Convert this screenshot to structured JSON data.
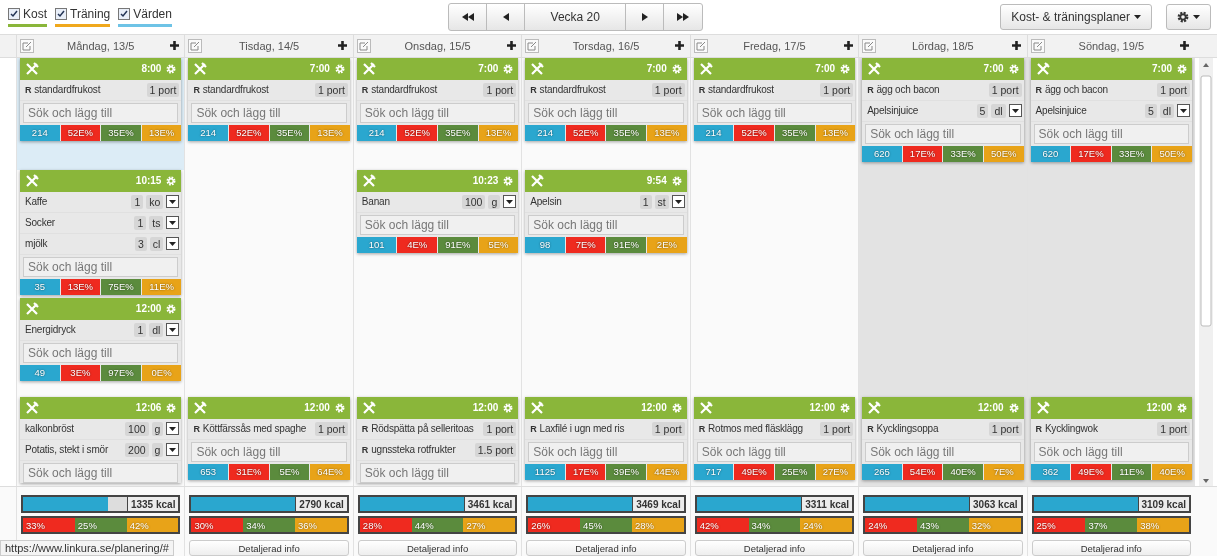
{
  "filters": [
    {
      "label": "Kost",
      "checked": true,
      "color": "#8ab63a"
    },
    {
      "label": "Träning",
      "checked": true,
      "color": "#f0a81c"
    },
    {
      "label": "Värden",
      "checked": true,
      "color": "#6ec3e6"
    }
  ],
  "week_nav": {
    "label": "Vecka 20"
  },
  "plans_menu": {
    "label": "Kost- & träningsplaner"
  },
  "days": [
    {
      "label": "Måndag, 13/5",
      "today": true,
      "weekend": false,
      "breakfast": {
        "time": "8:00",
        "items": [
          {
            "kind": "recipe",
            "marker": "R",
            "name": "standardfrukost",
            "portion": "1 port"
          }
        ],
        "search": {
          "placeholder": "Sök och lägg till"
        },
        "stats": [
          "214",
          "52E%",
          "35E%",
          "13E%"
        ]
      },
      "snack": {
        "time": "10:15",
        "items": [
          {
            "kind": "food",
            "name": "Kaffe",
            "amount": "1",
            "unit": "ko"
          },
          {
            "kind": "food",
            "name": "Socker",
            "amount": "1",
            "unit": "ts"
          },
          {
            "kind": "food",
            "name": "mjölk",
            "amount": "3",
            "unit": "cl"
          }
        ],
        "search": {
          "placeholder": "Sök och lägg till"
        },
        "stats": [
          "35",
          "13E%",
          "75E%",
          "11E%"
        ]
      },
      "noon": {
        "time": "12:00",
        "items": [
          {
            "kind": "food",
            "name": "Energidryck",
            "amount": "1",
            "unit": "dl"
          }
        ],
        "search": {
          "placeholder": "Sök och lägg till"
        },
        "stats": [
          "49",
          "3E%",
          "97E%",
          "0E%"
        ]
      },
      "lunch": {
        "time": "12:06",
        "items": [
          {
            "kind": "food",
            "name": "kalkonbröst",
            "amount": "100",
            "unit": "g"
          },
          {
            "kind": "food",
            "name": "Potatis, stekt i smör",
            "amount": "200",
            "unit": "g"
          }
        ],
        "search": {
          "placeholder": "Sök och lägg till"
        }
      },
      "summary": {
        "kcal": "1335 kcal",
        "level": 0.55,
        "macros": [
          {
            "label": "33%"
          },
          {
            "label": "25%"
          },
          {
            "label": "42%"
          }
        ]
      }
    },
    {
      "label": "Tisdag, 14/5",
      "today": false,
      "weekend": false,
      "breakfast": {
        "time": "7:00",
        "items": [
          {
            "kind": "recipe",
            "marker": "R",
            "name": "standardfrukost",
            "portion": "1 port"
          }
        ],
        "search": {
          "placeholder": "Sök och lägg till"
        },
        "stats": [
          "214",
          "52E%",
          "35E%",
          "13E%"
        ]
      },
      "lunch": {
        "time": "12:00",
        "items": [
          {
            "kind": "recipe",
            "marker": "R",
            "name": "Köttfärssås med spaghe",
            "portion": "1 port"
          }
        ],
        "search": {
          "placeholder": "Sök och lägg till"
        },
        "stats": [
          "653",
          "31E%",
          "5E%",
          "64E%"
        ]
      },
      "summary": {
        "kcal": "2790 kcal",
        "level": 1,
        "macros": [
          {
            "label": "30%"
          },
          {
            "label": "34%"
          },
          {
            "label": "36%"
          }
        ],
        "details_button": "Detaljerad info"
      }
    },
    {
      "label": "Onsdag, 15/5",
      "today": false,
      "weekend": false,
      "breakfast": {
        "time": "7:00",
        "items": [
          {
            "kind": "recipe",
            "marker": "R",
            "name": "standardfrukost",
            "portion": "1 port"
          }
        ],
        "search": {
          "placeholder": "Sök och lägg till"
        },
        "stats": [
          "214",
          "52E%",
          "35E%",
          "13E%"
        ]
      },
      "snack": {
        "time": "10:23",
        "items": [
          {
            "kind": "food",
            "name": "Banan",
            "amount": "100",
            "unit": "g"
          }
        ],
        "search": {
          "placeholder": "Sök och lägg till"
        },
        "stats": [
          "101",
          "4E%",
          "91E%",
          "5E%"
        ]
      },
      "lunch": {
        "time": "12:00",
        "items": [
          {
            "kind": "recipe",
            "marker": "R",
            "name": "Rödspätta på selleritoas",
            "portion": "1 port"
          },
          {
            "kind": "recipe",
            "marker": "R",
            "name": "ugnssteka rotfrukter",
            "portion": "1.5 port"
          }
        ],
        "search": {
          "placeholder": "Sök och lägg till"
        }
      },
      "summary": {
        "kcal": "3461 kcal",
        "level": 1,
        "macros": [
          {
            "label": "28%"
          },
          {
            "label": "44%"
          },
          {
            "label": "27%"
          }
        ],
        "details_button": "Detaljerad info"
      }
    },
    {
      "label": "Torsdag, 16/5",
      "today": false,
      "weekend": false,
      "breakfast": {
        "time": "7:00",
        "items": [
          {
            "kind": "recipe",
            "marker": "R",
            "name": "standardfrukost",
            "portion": "1 port"
          }
        ],
        "search": {
          "placeholder": "Sök och lägg till"
        },
        "stats": [
          "214",
          "52E%",
          "35E%",
          "13E%"
        ]
      },
      "snack": {
        "time": "9:54",
        "items": [
          {
            "kind": "food",
            "name": "Apelsin",
            "amount": "1",
            "unit": "st"
          }
        ],
        "search": {
          "placeholder": "Sök och lägg till"
        },
        "stats": [
          "98",
          "7E%",
          "91E%",
          "2E%"
        ]
      },
      "lunch": {
        "time": "12:00",
        "items": [
          {
            "kind": "recipe",
            "marker": "R",
            "name": "Laxfilé i ugn med ris",
            "portion": "1 port"
          }
        ],
        "search": {
          "placeholder": "Sök och lägg till"
        },
        "stats": [
          "1125",
          "17E%",
          "39E%",
          "44E%"
        ]
      },
      "summary": {
        "kcal": "3469 kcal",
        "level": 1,
        "macros": [
          {
            "label": "26%"
          },
          {
            "label": "45%"
          },
          {
            "label": "28%"
          }
        ],
        "details_button": "Detaljerad info"
      }
    },
    {
      "label": "Fredag, 17/5",
      "today": false,
      "weekend": false,
      "breakfast": {
        "time": "7:00",
        "items": [
          {
            "kind": "recipe",
            "marker": "R",
            "name": "standardfrukost",
            "portion": "1 port"
          }
        ],
        "search": {
          "placeholder": "Sök och lägg till"
        },
        "stats": [
          "214",
          "52E%",
          "35E%",
          "13E%"
        ]
      },
      "lunch": {
        "time": "12:00",
        "items": [
          {
            "kind": "recipe",
            "marker": "R",
            "name": "Rotmos med fläsklägg",
            "portion": "1 port"
          }
        ],
        "search": {
          "placeholder": "Sök och lägg till"
        },
        "stats": [
          "717",
          "49E%",
          "25E%",
          "27E%"
        ]
      },
      "summary": {
        "kcal": "3311 kcal",
        "level": 1,
        "macros": [
          {
            "label": "42%"
          },
          {
            "label": "34%"
          },
          {
            "label": "24%"
          }
        ],
        "details_button": "Detaljerad info"
      }
    },
    {
      "label": "Lördag, 18/5",
      "today": false,
      "weekend": true,
      "breakfast": {
        "time": "7:00",
        "items": [
          {
            "kind": "recipe",
            "marker": "R",
            "name": "ägg och bacon",
            "portion": "1 port"
          },
          {
            "kind": "food",
            "name": "Apelsinjuice",
            "amount": "5",
            "unit": "dl"
          }
        ],
        "search": {
          "placeholder": "Sök och lägg till"
        },
        "stats": [
          "620",
          "17E%",
          "33E%",
          "50E%"
        ]
      },
      "lunch": {
        "time": "12:00",
        "items": [
          {
            "kind": "recipe",
            "marker": "R",
            "name": "Kycklingsoppa",
            "portion": "1 port"
          }
        ],
        "search": {
          "placeholder": "Sök och lägg till"
        },
        "stats": [
          "265",
          "54E%",
          "40E%",
          "7E%"
        ]
      },
      "summary": {
        "kcal": "3063 kcal",
        "level": 1,
        "macros": [
          {
            "label": "24%"
          },
          {
            "label": "43%"
          },
          {
            "label": "32%"
          }
        ],
        "details_button": "Detaljerad info"
      }
    },
    {
      "label": "Söndag, 19/5",
      "today": false,
      "weekend": true,
      "breakfast": {
        "time": "7:00",
        "items": [
          {
            "kind": "recipe",
            "marker": "R",
            "name": "ägg och bacon",
            "portion": "1 port"
          },
          {
            "kind": "food",
            "name": "Apelsinjuice",
            "amount": "5",
            "unit": "dl"
          }
        ],
        "search": {
          "placeholder": "Sök och lägg till"
        },
        "stats": [
          "620",
          "17E%",
          "33E%",
          "50E%"
        ]
      },
      "lunch": {
        "time": "12:00",
        "items": [
          {
            "kind": "recipe",
            "marker": "R",
            "name": "Kycklingwok",
            "portion": "1 port"
          }
        ],
        "search": {
          "placeholder": "Sök och lägg till"
        },
        "stats": [
          "362",
          "49E%",
          "11E%",
          "40E%"
        ]
      },
      "summary": {
        "kcal": "3109 kcal",
        "level": 1,
        "macros": [
          {
            "label": "25%"
          },
          {
            "label": "37%"
          },
          {
            "label": "38%"
          }
        ],
        "details_button": "Detaljerad info"
      }
    }
  ],
  "status_url": "https://www.linkura.se/planering/#"
}
